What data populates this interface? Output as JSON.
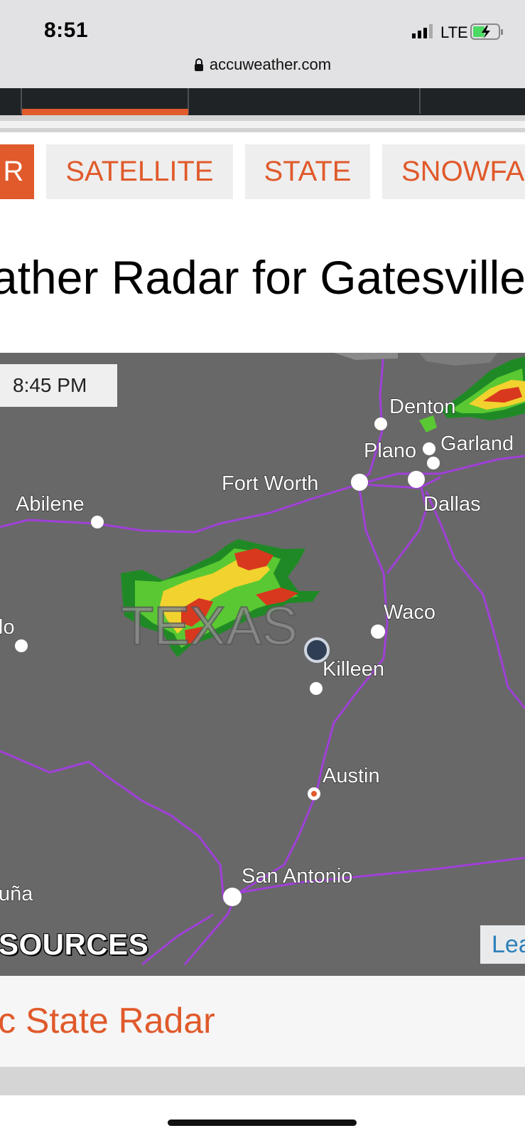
{
  "status_bar": {
    "time": "8:51",
    "network": "LTE",
    "url": "accuweather.com"
  },
  "icons": {
    "signal": "cell-signal-icon",
    "battery": "battery-charging-icon",
    "lock": "lock-icon",
    "location": "location-marker-icon"
  },
  "colors": {
    "accent": "#e05a2b",
    "nav_dark": "#1f2326",
    "route": "#a040d8",
    "map_bg": "#686868"
  },
  "tabs": [
    {
      "label": "R"
    },
    {
      "label": "SATELLITE"
    },
    {
      "label": "STATE"
    },
    {
      "label": "SNOWFA"
    }
  ],
  "page_title": "ather Radar for Gatesville",
  "map": {
    "timestamp": "8:45 PM",
    "region_label": "TEXAS",
    "cities": [
      "Denton",
      "Plano",
      "Garland",
      "Fort Worth",
      "Dallas",
      "Abilene",
      "Waco",
      "Killeen",
      "Austin",
      "San Antonio",
      "lo",
      "uña"
    ],
    "sources_label": "SOURCES",
    "attribution": "Lea"
  },
  "footer_link": "ic State Radar"
}
